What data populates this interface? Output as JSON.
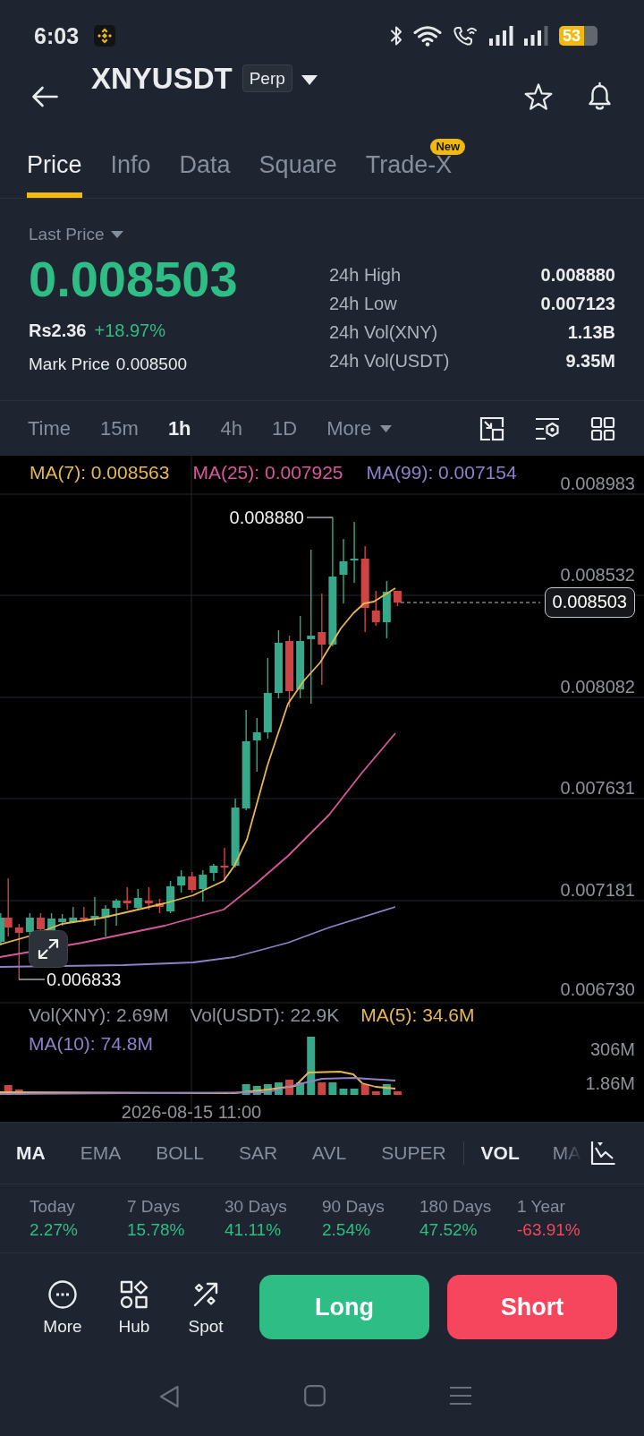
{
  "status_bar": {
    "time": "6:03",
    "battery": "53"
  },
  "header": {
    "symbol": "XNYUSDT",
    "tag": "Perp"
  },
  "tabs": [
    {
      "label": "Price",
      "selected": true
    },
    {
      "label": "Info",
      "selected": false
    },
    {
      "label": "Data",
      "selected": false
    },
    {
      "label": "Square",
      "selected": false
    },
    {
      "label": "Trade-X",
      "selected": false,
      "badge": "New"
    }
  ],
  "price_summary": {
    "selector": "Last Price",
    "last_price": "0.008503",
    "fiat_price": "Rs2.36",
    "change": "+18.97%",
    "mark_price": {
      "label": "Mark Price",
      "value": "0.008500"
    },
    "stats": [
      {
        "label": "24h High",
        "value": "0.008880"
      },
      {
        "label": "24h Low",
        "value": "0.007123"
      },
      {
        "label": "24h Vol(XNY)",
        "value": "1.13B"
      },
      {
        "label": "24h Vol(USDT)",
        "value": "9.35M"
      }
    ]
  },
  "intervals": [
    {
      "label": "Time",
      "selected": false
    },
    {
      "label": "15m",
      "selected": false
    },
    {
      "label": "1h",
      "selected": true
    },
    {
      "label": "4h",
      "selected": false
    },
    {
      "label": "1D",
      "selected": false
    }
  ],
  "more_intervals": {
    "label": "More"
  },
  "chart": {
    "ma_legend": [
      {
        "label": "MA(7): 0.008563",
        "color": "#e6b84f"
      },
      {
        "label": "MA(25): 0.007925",
        "color": "#d9579c"
      },
      {
        "label": "MA(99): 0.007154",
        "color": "#8f80c8"
      }
    ],
    "price_axis": [
      "0.008983",
      "0.008532",
      "0.008082",
      "0.007631",
      "0.007181",
      "0.006730"
    ],
    "high_marker": "0.008880",
    "low_marker": "0.006833",
    "current_price": "0.008503",
    "volume_legend": [
      {
        "label": "Vol(XNY): 2.69M",
        "color": "#8f949c"
      },
      {
        "label": "Vol(USDT): 22.9K",
        "color": "#8f949c"
      },
      {
        "label": "MA(5): 34.6M",
        "color": "#e6b84f"
      },
      {
        "label": "MA(10): 74.8M",
        "color": "#8f80c8"
      }
    ],
    "volume_axis": [
      "306M",
      "1.86M"
    ],
    "time_label": "2026-08-15 11:00"
  },
  "indicators": {
    "main": [
      {
        "label": "MA",
        "selected": true
      },
      {
        "label": "EMA",
        "selected": false
      },
      {
        "label": "BOLL",
        "selected": false
      },
      {
        "label": "SAR",
        "selected": false
      },
      {
        "label": "AVL",
        "selected": false
      },
      {
        "label": "SUPER",
        "selected": false
      }
    ],
    "sub": [
      {
        "label": "VOL",
        "selected": true
      },
      {
        "label": "MA",
        "selected": false
      }
    ]
  },
  "returns": [
    {
      "period": "Today",
      "value": "2.27%",
      "color": "#2ebd85"
    },
    {
      "period": "7 Days",
      "value": "15.78%",
      "color": "#2ebd85"
    },
    {
      "period": "30 Days",
      "value": "41.11%",
      "color": "#2ebd85"
    },
    {
      "period": "90 Days",
      "value": "2.54%",
      "color": "#2ebd85"
    },
    {
      "period": "180 Days",
      "value": "47.52%",
      "color": "#2ebd85"
    },
    {
      "period": "1 Year",
      "value": "-63.91%",
      "color": "#f6465d"
    }
  ],
  "actions": {
    "tools": [
      {
        "label": "More"
      },
      {
        "label": "Hub"
      },
      {
        "label": "Spot"
      }
    ],
    "long": "Long",
    "short": "Short"
  }
}
